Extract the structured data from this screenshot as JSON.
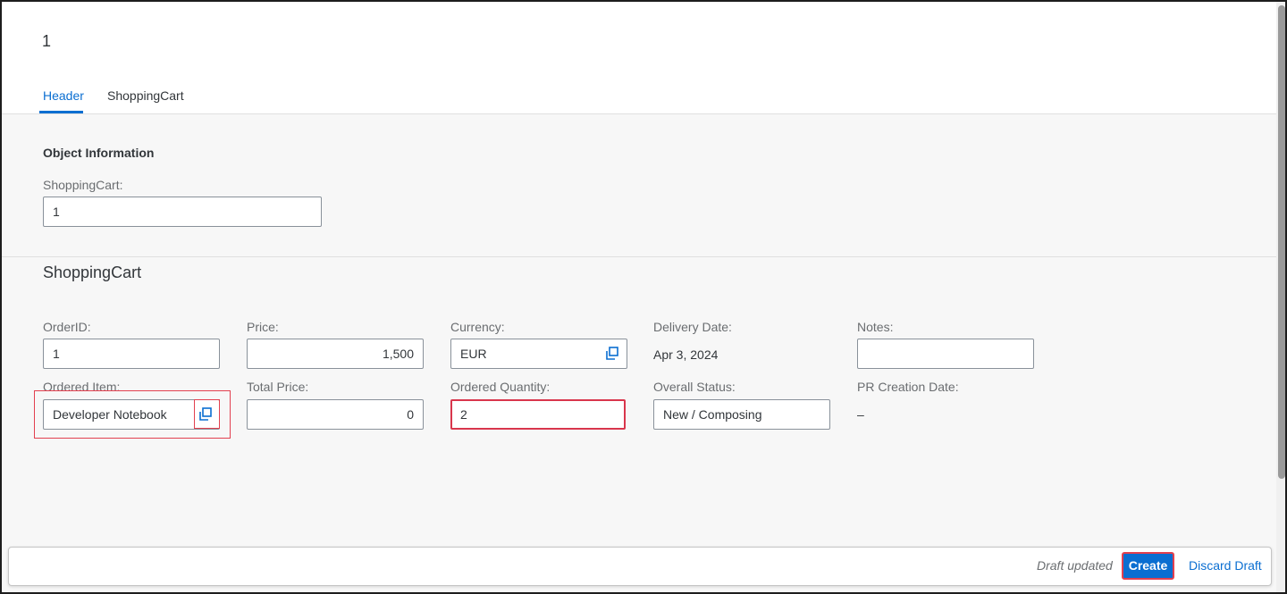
{
  "object": {
    "title": "1"
  },
  "tabs": [
    {
      "label": "Header",
      "active": true
    },
    {
      "label": "ShoppingCart",
      "active": false
    }
  ],
  "header_section": {
    "group_title": "Object Information",
    "shopping_cart_label": "ShoppingCart:",
    "shopping_cart_value": "1"
  },
  "cart_section": {
    "title": "ShoppingCart",
    "order_id": {
      "label": "OrderID:",
      "value": "1"
    },
    "price": {
      "label": "Price:",
      "value": "1,500"
    },
    "currency": {
      "label": "Currency:",
      "value": "EUR"
    },
    "delivery_date": {
      "label": "Delivery Date:",
      "value": "Apr 3, 2024"
    },
    "notes": {
      "label": "Notes:",
      "value": ""
    },
    "ordered_item": {
      "label": "Ordered Item:",
      "value": "Developer Notebook"
    },
    "total_price": {
      "label": "Total Price:",
      "value": "0"
    },
    "ordered_quantity": {
      "label": "Ordered Quantity:",
      "value": "2"
    },
    "overall_status": {
      "label": "Overall Status:",
      "value": "New / Composing"
    },
    "pr_creation_date": {
      "label": "PR Creation Date:",
      "value": "–"
    }
  },
  "footer": {
    "draft_status": "Draft updated",
    "create_label": "Create",
    "discard_label": "Discard Draft"
  },
  "colors": {
    "accent": "#0a6ed1",
    "error": "#d9364c",
    "highlight": "#e2404f"
  },
  "icons": {
    "value_help": "value-help-icon"
  }
}
